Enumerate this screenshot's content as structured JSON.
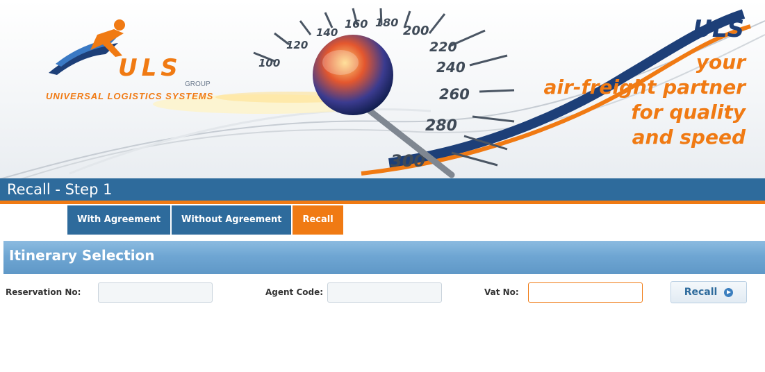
{
  "banner": {
    "logo_text": "ULS",
    "group_text": "GROUP",
    "company_name": "UNIVERSAL LOGISTICS SYSTEMS",
    "brand_top": "ULS",
    "tagline_lines": [
      "your",
      "air-freight partner",
      "for quality",
      "and speed"
    ],
    "speedometer_labels": [
      "100",
      "120",
      "140",
      "160",
      "180",
      "200",
      "220",
      "240",
      "260",
      "280",
      "300"
    ]
  },
  "page": {
    "title": "Recall - Step 1"
  },
  "tabs": [
    {
      "label": "With Agreement",
      "active": false
    },
    {
      "label": "Without Agreement",
      "active": false
    },
    {
      "label": "Recall",
      "active": true
    }
  ],
  "section": {
    "title": "Itinerary Selection"
  },
  "form": {
    "reservation_label": "Reservation No:",
    "reservation_value": "",
    "agent_label": "Agent Code:",
    "agent_value": "",
    "vat_label": "Vat No:",
    "vat_value": "",
    "submit_label": "Recall"
  },
  "colors": {
    "primary_blue": "#2e6b9c",
    "accent_orange": "#f07a13",
    "brand_navy": "#1d3f78"
  },
  "icons": {
    "submit_icon": "arrow-right-circle-icon"
  }
}
